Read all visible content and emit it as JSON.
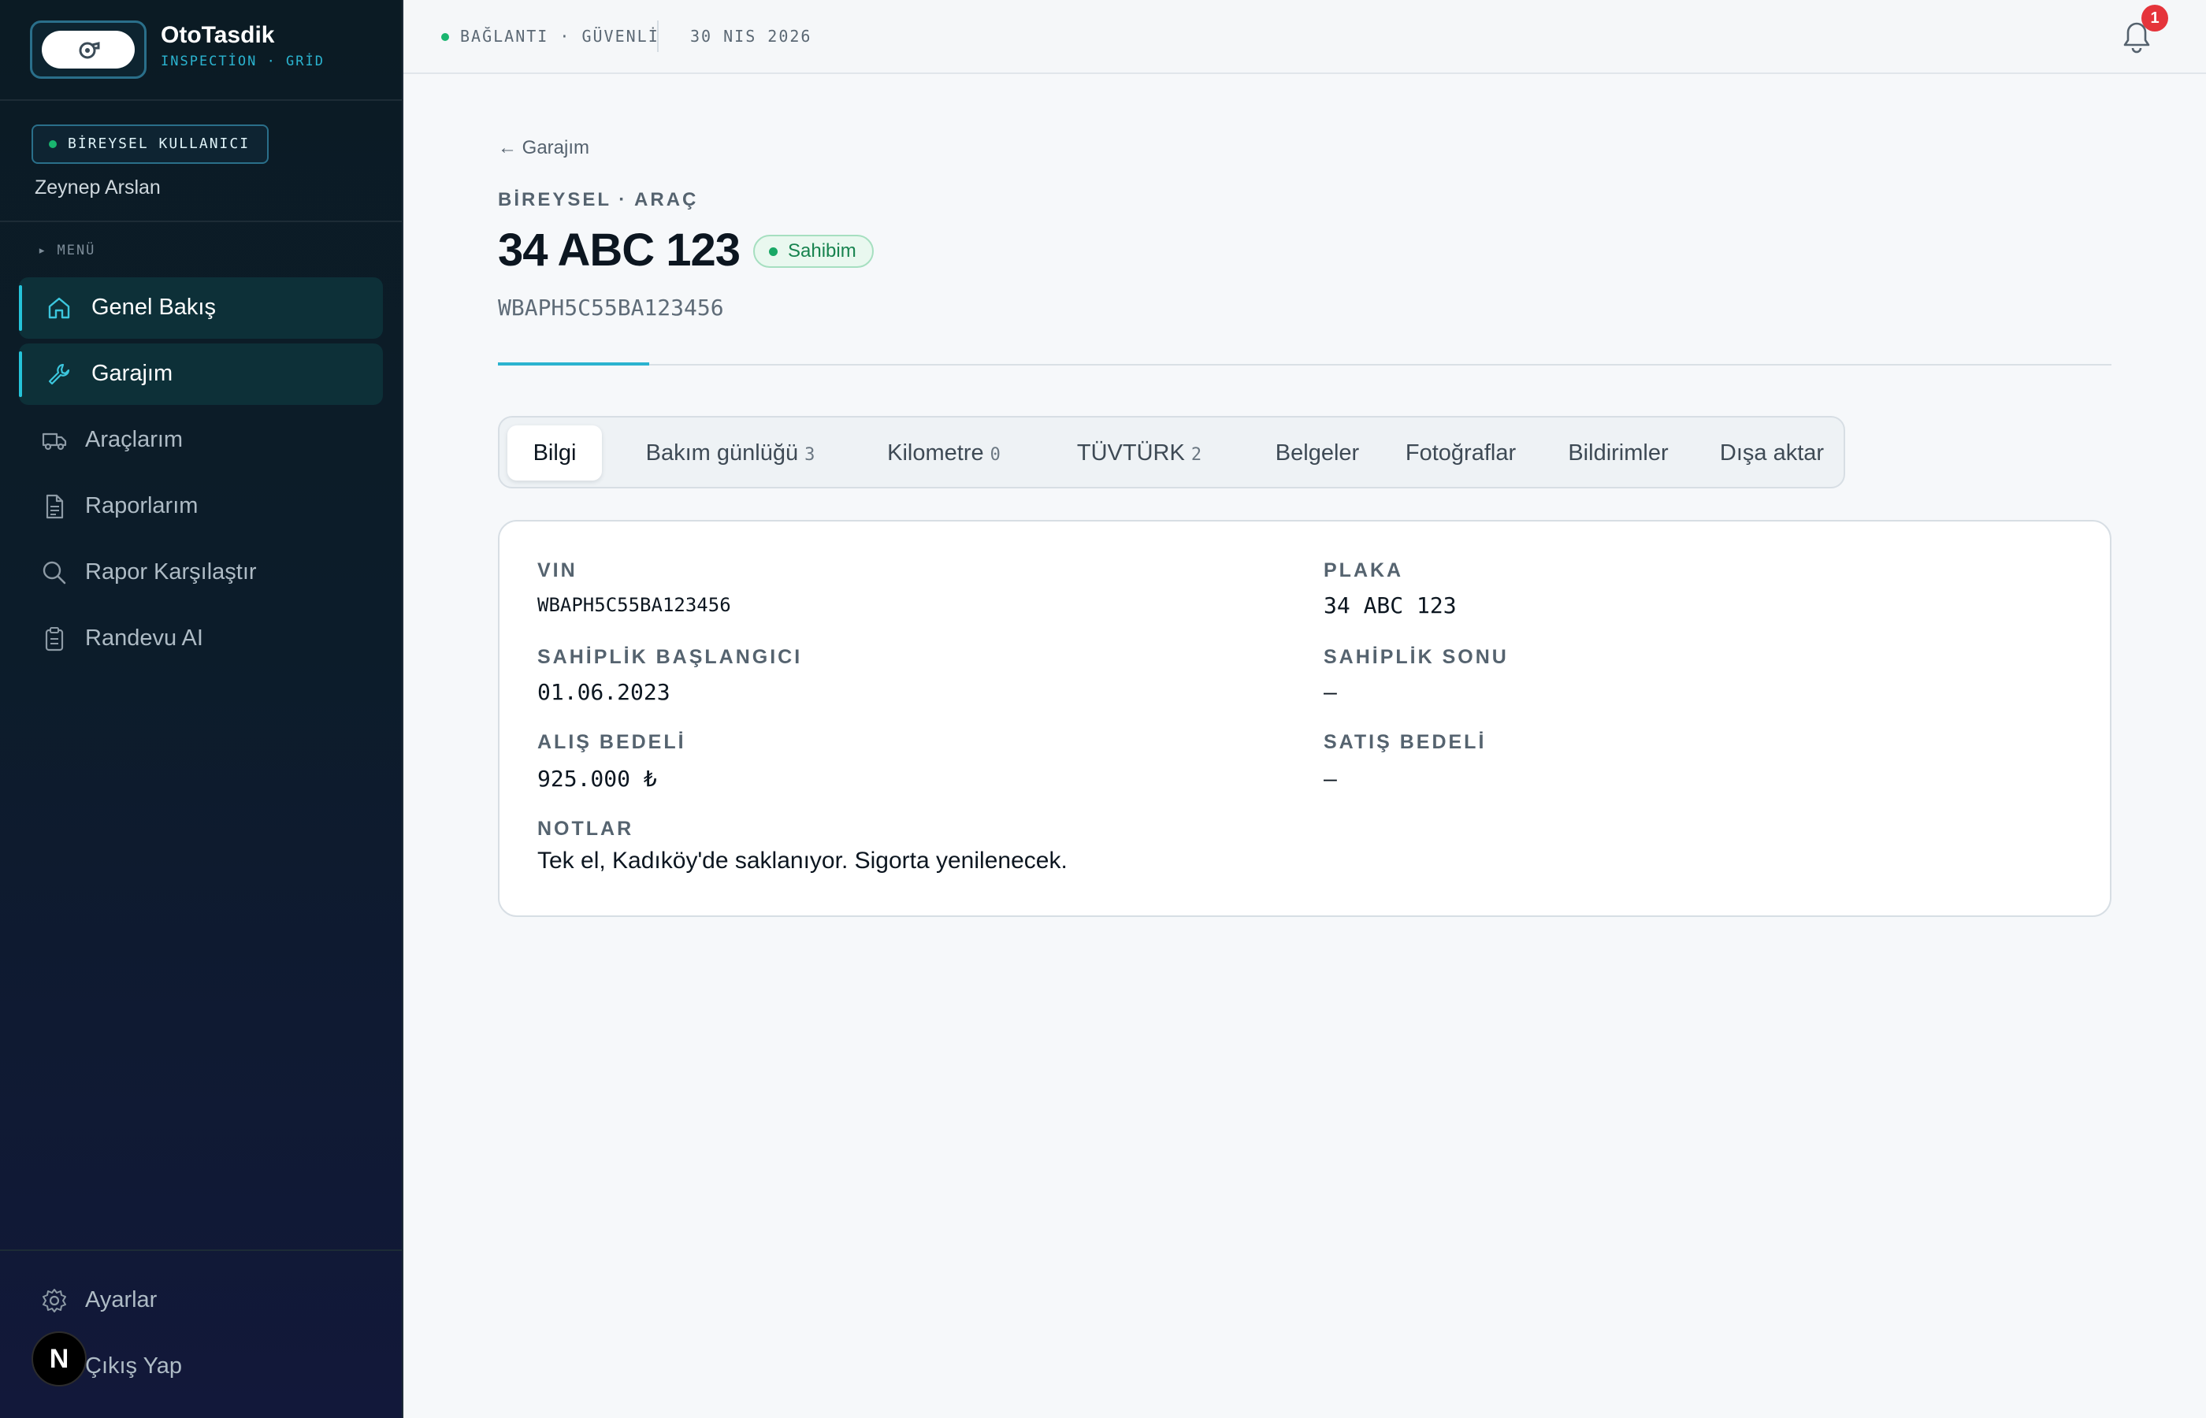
{
  "brand": {
    "name": "OtoTasdik",
    "subtitle": "INSPECTİON · GRİD"
  },
  "user": {
    "badge": "BİREYSEL KULLANICI",
    "name": "Zeynep Arslan"
  },
  "menu": {
    "label": "▸ MENÜ",
    "items": [
      {
        "label": "Genel Bakış",
        "icon": "home-icon",
        "active": true
      },
      {
        "label": "Garajım",
        "icon": "wrench-icon",
        "active": true
      },
      {
        "label": "Araçlarım",
        "icon": "truck-icon",
        "active": false
      },
      {
        "label": "Raporlarım",
        "icon": "document-icon",
        "active": false
      },
      {
        "label": "Rapor Karşılaştır",
        "icon": "search-icon",
        "active": false
      },
      {
        "label": "Randevu AI",
        "icon": "clipboard-icon",
        "active": false
      }
    ],
    "bottom": [
      {
        "label": "Ayarlar",
        "icon": "gear-icon"
      },
      {
        "label": "Çıkış Yap",
        "icon": "logout-icon"
      }
    ]
  },
  "n_badge": "N",
  "topbar": {
    "connection": "BAĞLANTI · GÜVENLİ",
    "date": "30 NIS 2026",
    "notification_count": "1"
  },
  "vehicle": {
    "back": "← Garajım",
    "eyebrow": "BİREYSEL · ARAÇ",
    "plate": "34 ABC 123",
    "owner_tag": "Sahibim",
    "vin": "WBAPH5C55BA123456"
  },
  "tabs": [
    {
      "label": "Bilgi",
      "count": ""
    },
    {
      "label": "Bakım günlüğü",
      "count": "3"
    },
    {
      "label": "Kilometre",
      "count": "0"
    },
    {
      "label": "TÜVTÜRK",
      "count": "2"
    },
    {
      "label": "Belgeler",
      "count": ""
    },
    {
      "label": "Fotoğraflar",
      "count": ""
    },
    {
      "label": "Bildirimler",
      "count": ""
    },
    {
      "label": "Dışa aktar",
      "count": ""
    }
  ],
  "info": {
    "vin_label": "VIN",
    "vin_value": "WBAPH5C55BA123456",
    "plate_label": "PLAKA",
    "plate_value": "34 ABC 123",
    "own_start_label": "SAHİPLİK BAŞLANGICI",
    "own_start_value": "01.06.2023",
    "own_end_label": "SAHİPLİK SONU",
    "own_end_value": "—",
    "buy_label": "ALIŞ BEDELİ",
    "buy_value": "925.000 ₺",
    "sell_label": "SATIŞ BEDELİ",
    "sell_value": "—",
    "notes_label": "NOTLAR",
    "notes_value": "Tek el, Kadıköy'de saklanıyor. Sigorta yenilenecek."
  },
  "colors": {
    "accent": "#2bb3cf",
    "success": "#19b56f",
    "danger": "#e5343b",
    "sidebar": "#0b1b24"
  }
}
